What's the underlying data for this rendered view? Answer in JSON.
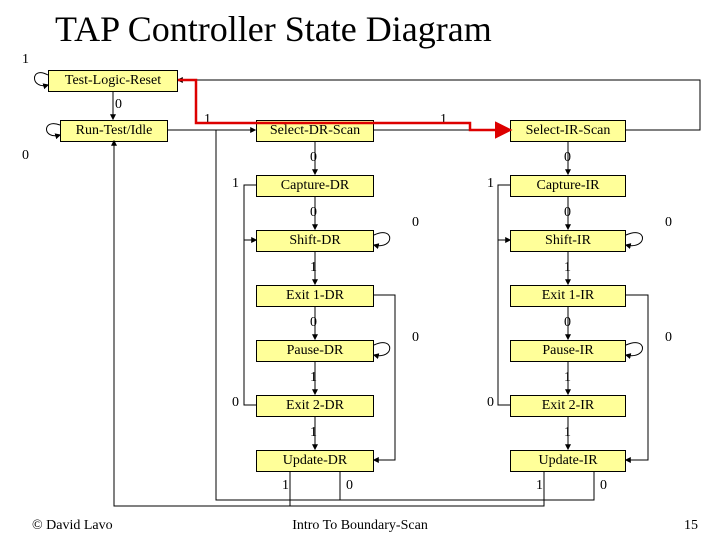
{
  "title": "TAP Controller State Diagram",
  "states": {
    "tlr": "Test-Logic-Reset",
    "rti": "Run-Test/Idle",
    "sel_dr": "Select-DR-Scan",
    "sel_ir": "Select-IR-Scan",
    "cap_dr": "Capture-DR",
    "cap_ir": "Capture-IR",
    "shf_dr": "Shift-DR",
    "shf_ir": "Shift-IR",
    "ex1_dr": "Exit 1-DR",
    "ex1_ir": "Exit 1-IR",
    "pau_dr": "Pause-DR",
    "pau_ir": "Pause-IR",
    "ex2_dr": "Exit 2-DR",
    "ex2_ir": "Exit 2-IR",
    "upd_dr": "Update-DR",
    "upd_ir": "Update-IR"
  },
  "labels": {
    "tlr_self": "1",
    "tlr_rti": "0",
    "rti_self": "0",
    "rti_seldr": "1",
    "seldr_selir": "1",
    "seldr_capdr": "0",
    "selir_capir": "0",
    "capdr_left": "1",
    "capdr_shfdr": "0",
    "capir_left": "1",
    "capir_shfir": "0",
    "shfdr_self": "0",
    "shfir_self": "0",
    "shfdr_ex1dr": "1",
    "shfir_ex1ir": "1",
    "ex1dr_paudr": "0",
    "ex1ir_pauir": "0",
    "paudr_self": "0",
    "pauir_self": "0",
    "paudr_ex2dr": "1",
    "pauir_ex2ir": "1",
    "ex2dr_left": "0",
    "ex2ir_left": "0",
    "ex2dr_upddr": "1",
    "ex2ir_updir": "1",
    "upddr_left": "1",
    "upddr_right": "0",
    "updir_left": "1",
    "updir_right": "0"
  },
  "footer": {
    "left": "© David Lavo",
    "center": "Intro To Boundary-Scan",
    "right": "15"
  }
}
